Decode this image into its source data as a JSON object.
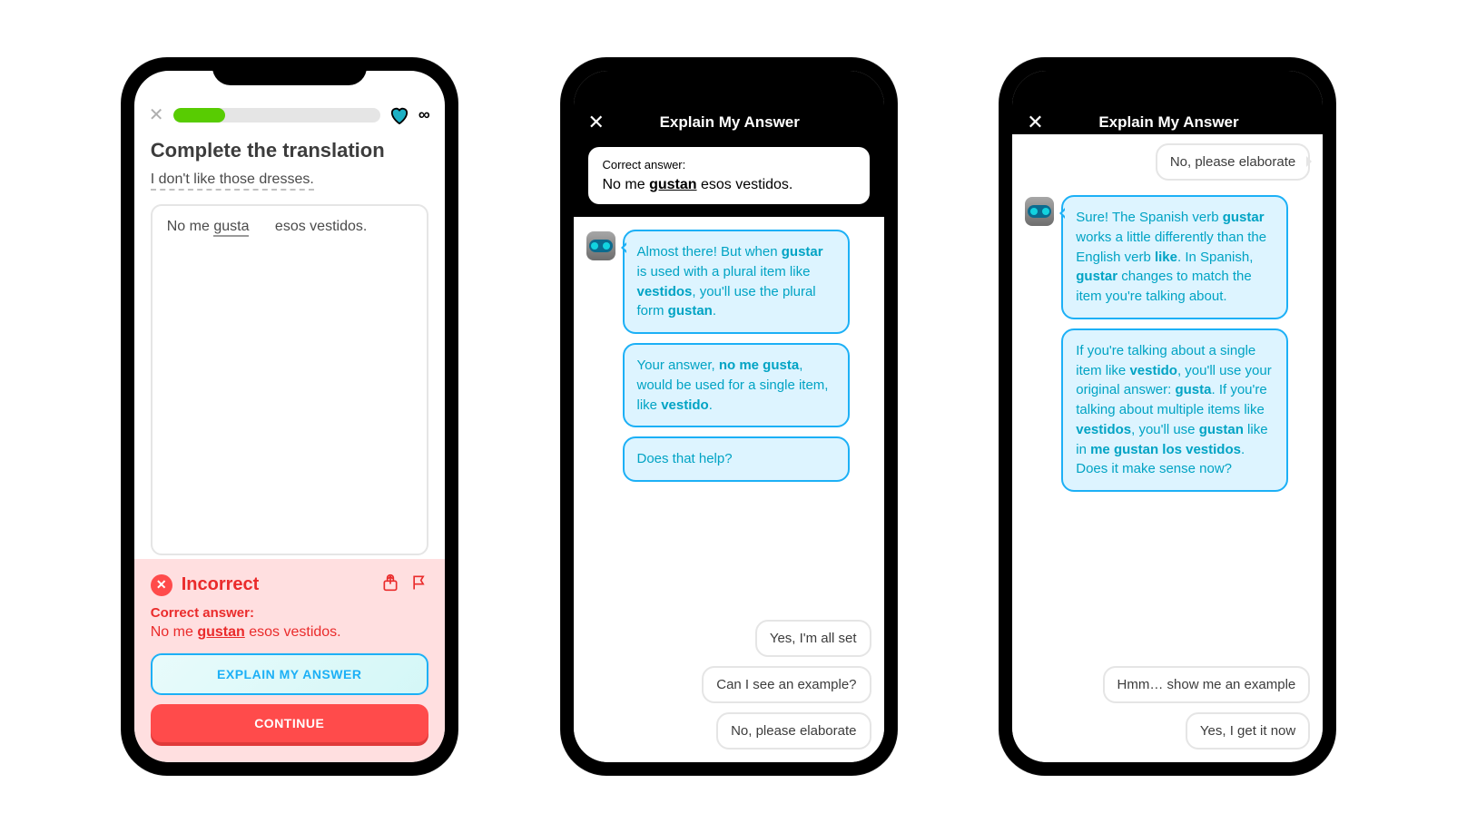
{
  "phone1": {
    "progress_pct": 25,
    "infinity": "∞",
    "title": "Complete the translation",
    "sentence": "I don't like those dresses.",
    "answer_pre": "No me ",
    "answer_underline": "gusta",
    "answer_post": "esos vestidos.",
    "feedback": {
      "incorrect": "Incorrect",
      "correct_label": "Correct answer:",
      "correct_pre": "No me ",
      "correct_bold": "gustan",
      "correct_post": " esos vestidos.",
      "explain_btn": "EXPLAIN MY ANSWER",
      "continue_btn": "CONTINUE"
    }
  },
  "phone2": {
    "title": "Explain My Answer",
    "correct_label": "Correct answer:",
    "correct_pre": "No me ",
    "correct_bold": "gustan",
    "correct_post": " esos vestidos.",
    "bot1_a": "Almost there! But when ",
    "bot1_b": "gustar",
    "bot1_c": " is used with a plural item like ",
    "bot1_d": "vestidos",
    "bot1_e": ", you'll use the plural form ",
    "bot1_f": "gustan",
    "bot1_g": ".",
    "bot2_a": "Your answer, ",
    "bot2_b": "no me gusta",
    "bot2_c": ", would be used for a single item, like ",
    "bot2_d": "vestido",
    "bot2_e": ".",
    "bot3": "Does that help?",
    "opt1": "Yes, I'm all set",
    "opt2": "Can I see an example?",
    "opt3": "No, please elaborate"
  },
  "phone3": {
    "title": "Explain My Answer",
    "user_top": "No, please elaborate",
    "bot1_a": "Sure! The Spanish verb ",
    "bot1_b": "gustar",
    "bot1_c": " works a little differently than the English verb ",
    "bot1_d": "like",
    "bot1_e": ". In Spanish, ",
    "bot1_f": "gustar",
    "bot1_g": " changes to match the item you're talking about.",
    "bot2_a": "If you're talking about a single item like ",
    "bot2_b": "vestido",
    "bot2_c": ", you'll use your original answer: ",
    "bot2_d": "gusta",
    "bot2_e": ". If you're talking about multiple items like ",
    "bot2_f": "vestidos",
    "bot2_g": ", you'll use ",
    "bot2_h": "gustan",
    "bot2_i": " like in ",
    "bot2_j": "me gustan los vestidos",
    "bot2_k": ". Does it make sense now?",
    "opt1": "Hmm… show me an example",
    "opt2": "Yes, I get it now"
  }
}
